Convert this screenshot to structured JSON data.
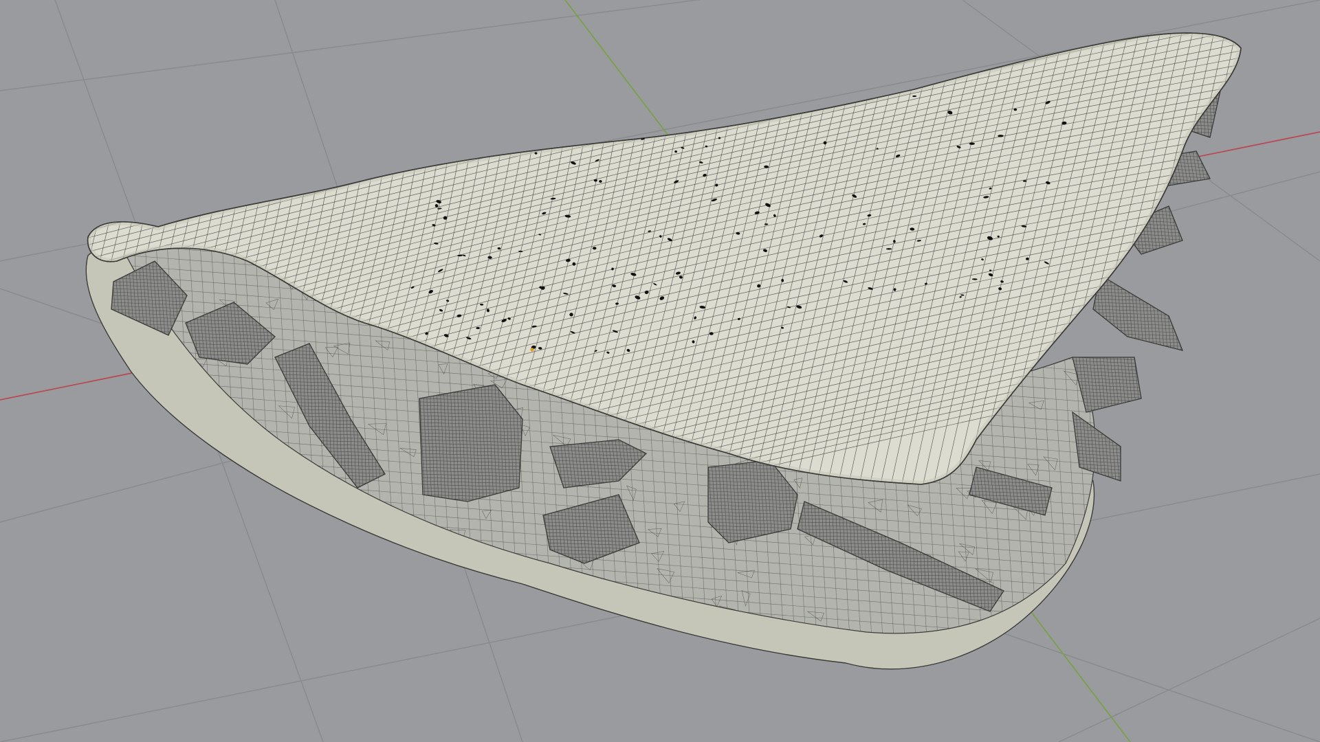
{
  "viewport": {
    "background_color": "#999b9e",
    "grid_color": "#8a8c8f",
    "x_axis_color": "#b84a55",
    "y_axis_color": "#7aa04a",
    "shell_color": "#dcdcd0",
    "shell_shadow_color": "#c6c6b8",
    "filling_color": "#b4b4ae",
    "block_color": "#8c8c8a",
    "wire_color": "#3a3a38",
    "origin_marker_color": "#e0a020"
  },
  "scene": {
    "object": "empanada-mesh",
    "display_mode": "wireframe-overlay",
    "filling_pieces": 22,
    "surface_holes": 160
  },
  "icons": {
    "grid": "floor-grid-icon",
    "x_axis": "x-axis-line-icon",
    "y_axis": "y-axis-line-icon",
    "origin": "object-origin-icon"
  }
}
